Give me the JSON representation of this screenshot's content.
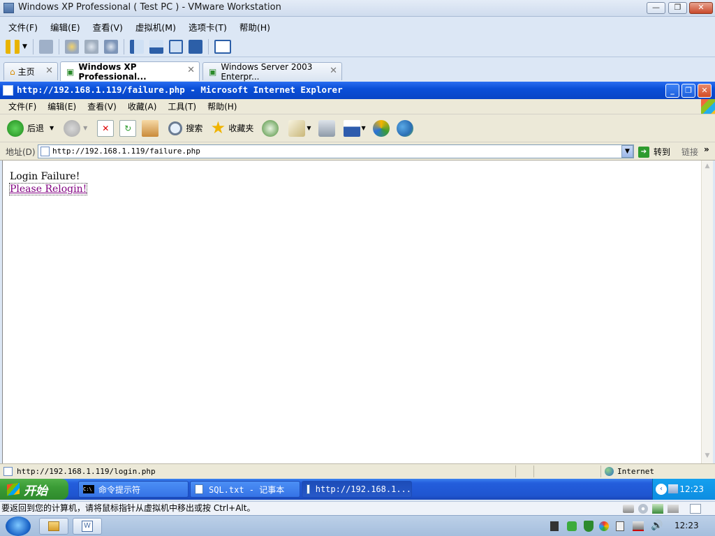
{
  "vmware": {
    "title": "Windows XP Professional ( Test PC ) - VMware Workstation",
    "menu": [
      "文件(F)",
      "编辑(E)",
      "查看(V)",
      "虚拟机(M)",
      "选项卡(T)",
      "帮助(H)"
    ],
    "tabs": [
      {
        "label": "主页",
        "icon": "home-icon"
      },
      {
        "label": "Windows XP Professional...",
        "icon": "vm-icon",
        "active": true
      },
      {
        "label": "Windows Server 2003 Enterpr...",
        "icon": "vm-icon"
      }
    ],
    "status_text": "要返回到您的计算机，请将鼠标指针从虚拟机中移出或按 Ctrl+Alt。"
  },
  "ie": {
    "title": "http://192.168.1.119/failure.php - Microsoft Internet Explorer",
    "menu": [
      "文件(F)",
      "编辑(E)",
      "查看(V)",
      "收藏(A)",
      "工具(T)",
      "帮助(H)"
    ],
    "toolbar": {
      "back": "后退",
      "search": "搜索",
      "favorites": "收藏夹"
    },
    "address": {
      "label": "地址(D)",
      "value": "http://192.168.1.119/failure.php",
      "go": "转到",
      "links": "链接"
    },
    "content": {
      "line1": "Login Failure!",
      "link": "Please Relogin!"
    },
    "status": {
      "url": "http://192.168.1.119/login.php",
      "zone": "Internet"
    }
  },
  "xp_taskbar": {
    "start": "开始",
    "tasks": [
      "命令提示符",
      "SQL.txt - 记事本",
      "http://192.168.1..."
    ],
    "clock": "12:23"
  },
  "host_taskbar": {
    "clock": "12:23"
  },
  "colors": {
    "xp_blue": "#245edc",
    "xp_green": "#3a9c36",
    "link_purple": "#800080"
  }
}
